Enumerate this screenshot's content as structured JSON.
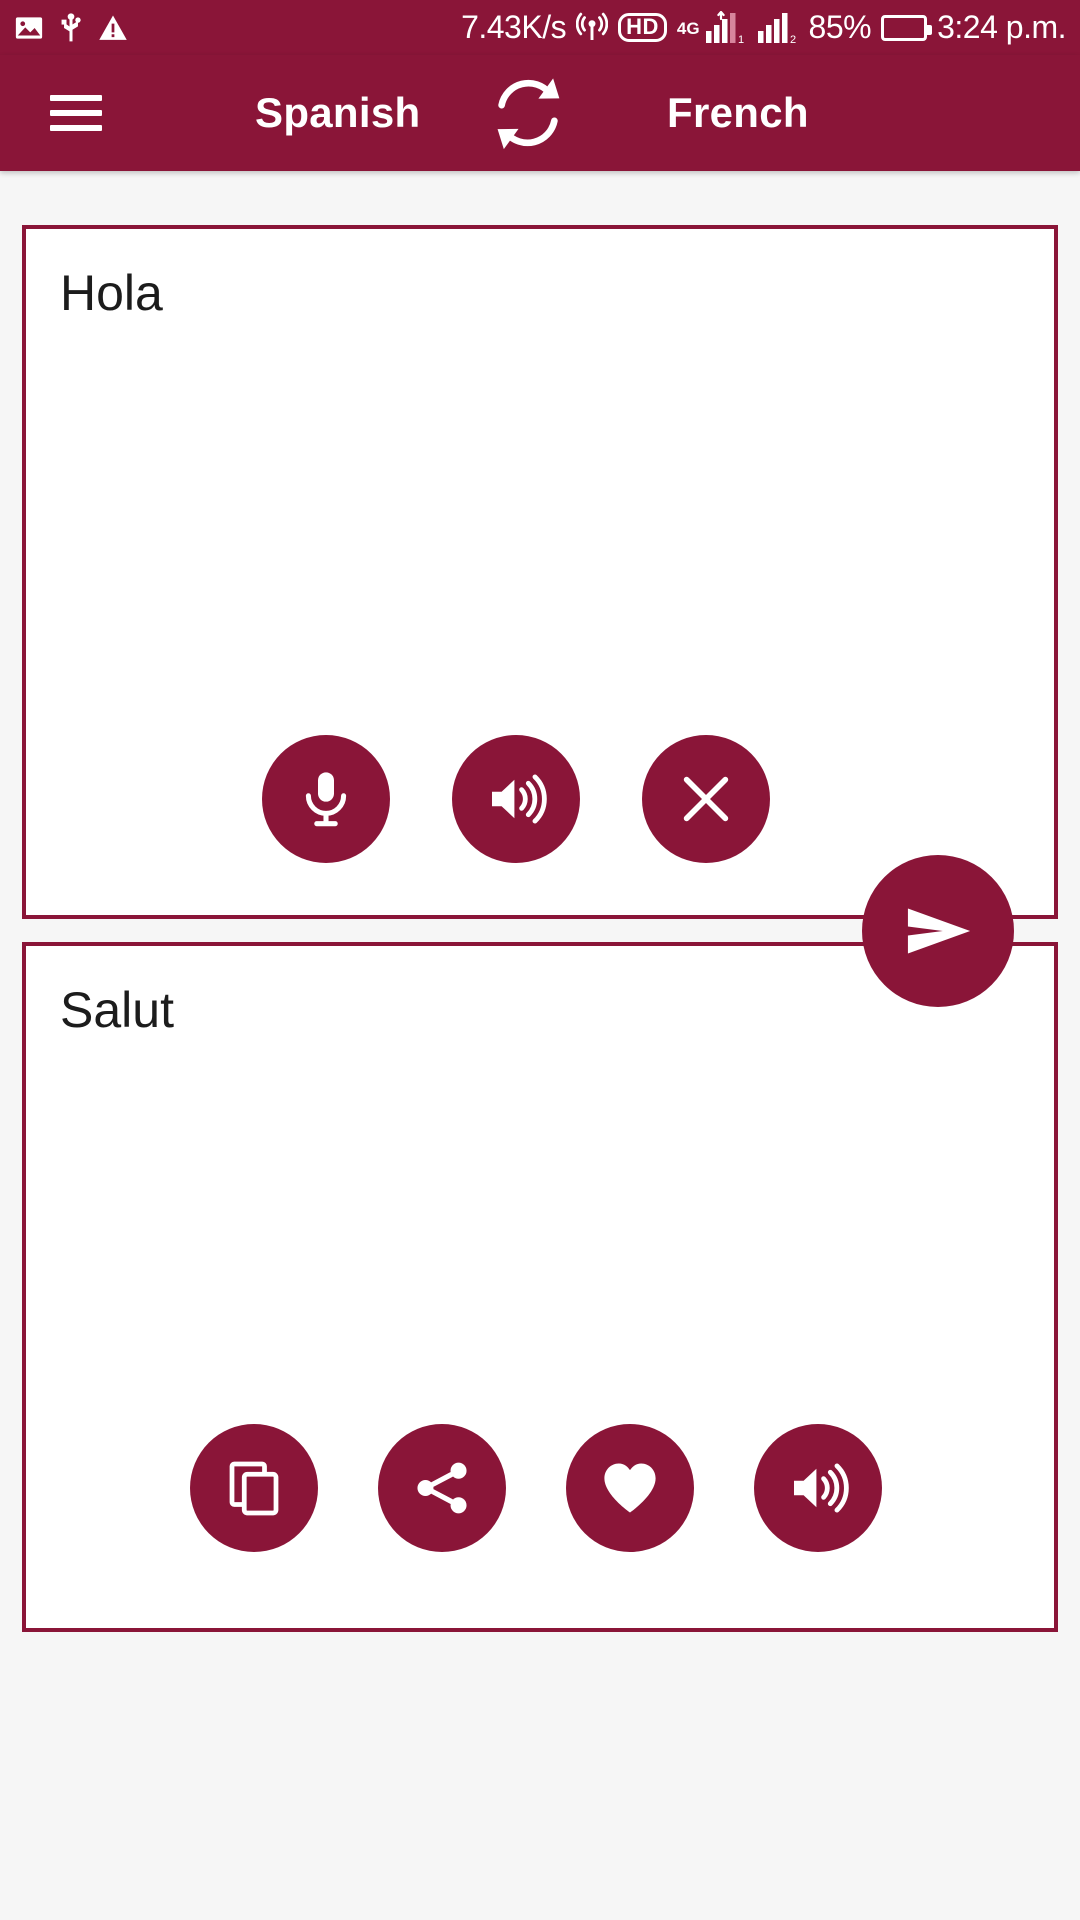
{
  "status_bar": {
    "icons_left": [
      "image-icon",
      "usb-icon",
      "warning-icon"
    ],
    "network_speed": "7.43K/s",
    "hotspot_icon": "hotspot-icon",
    "hd_label": "HD",
    "network_generation": "4G",
    "signal_icon_1": "signal-bars-sim1-icon",
    "signal_icon_2": "signal-bars-sim2-icon",
    "battery_percent": "85%",
    "battery_level": 85,
    "battery_icon": "battery-full-icon",
    "clock": "3:24 p.m."
  },
  "app_bar": {
    "menu_icon": "hamburger-menu-icon",
    "source_language": "Spanish",
    "swap_icon": "swap-languages-icon",
    "target_language": "French"
  },
  "source_card": {
    "text": "Hola",
    "placeholder": "Hola",
    "actions": [
      {
        "name": "microphone-button",
        "icon": "microphone-icon",
        "label": "Speak"
      },
      {
        "name": "speak-source-button",
        "icon": "speaker-icon",
        "label": "Listen"
      },
      {
        "name": "clear-button",
        "icon": "close-icon",
        "label": "Clear"
      }
    ]
  },
  "target_card": {
    "text": "Salut",
    "actions": [
      {
        "name": "copy-button",
        "icon": "copy-icon",
        "label": "Copy"
      },
      {
        "name": "share-button",
        "icon": "share-icon",
        "label": "Share"
      },
      {
        "name": "favorite-button",
        "icon": "heart-icon",
        "label": "Favorite"
      },
      {
        "name": "speak-target-button",
        "icon": "speaker-icon",
        "label": "Listen"
      }
    ]
  },
  "send_button": {
    "icon": "send-icon",
    "label": "Translate"
  },
  "colors": {
    "primary": "#8a1538",
    "on_primary": "#ffffff",
    "card_background": "#ffffff",
    "page_background": "#f6f6f6",
    "text": "#1c1c1c",
    "battery_green": "#27d507"
  }
}
